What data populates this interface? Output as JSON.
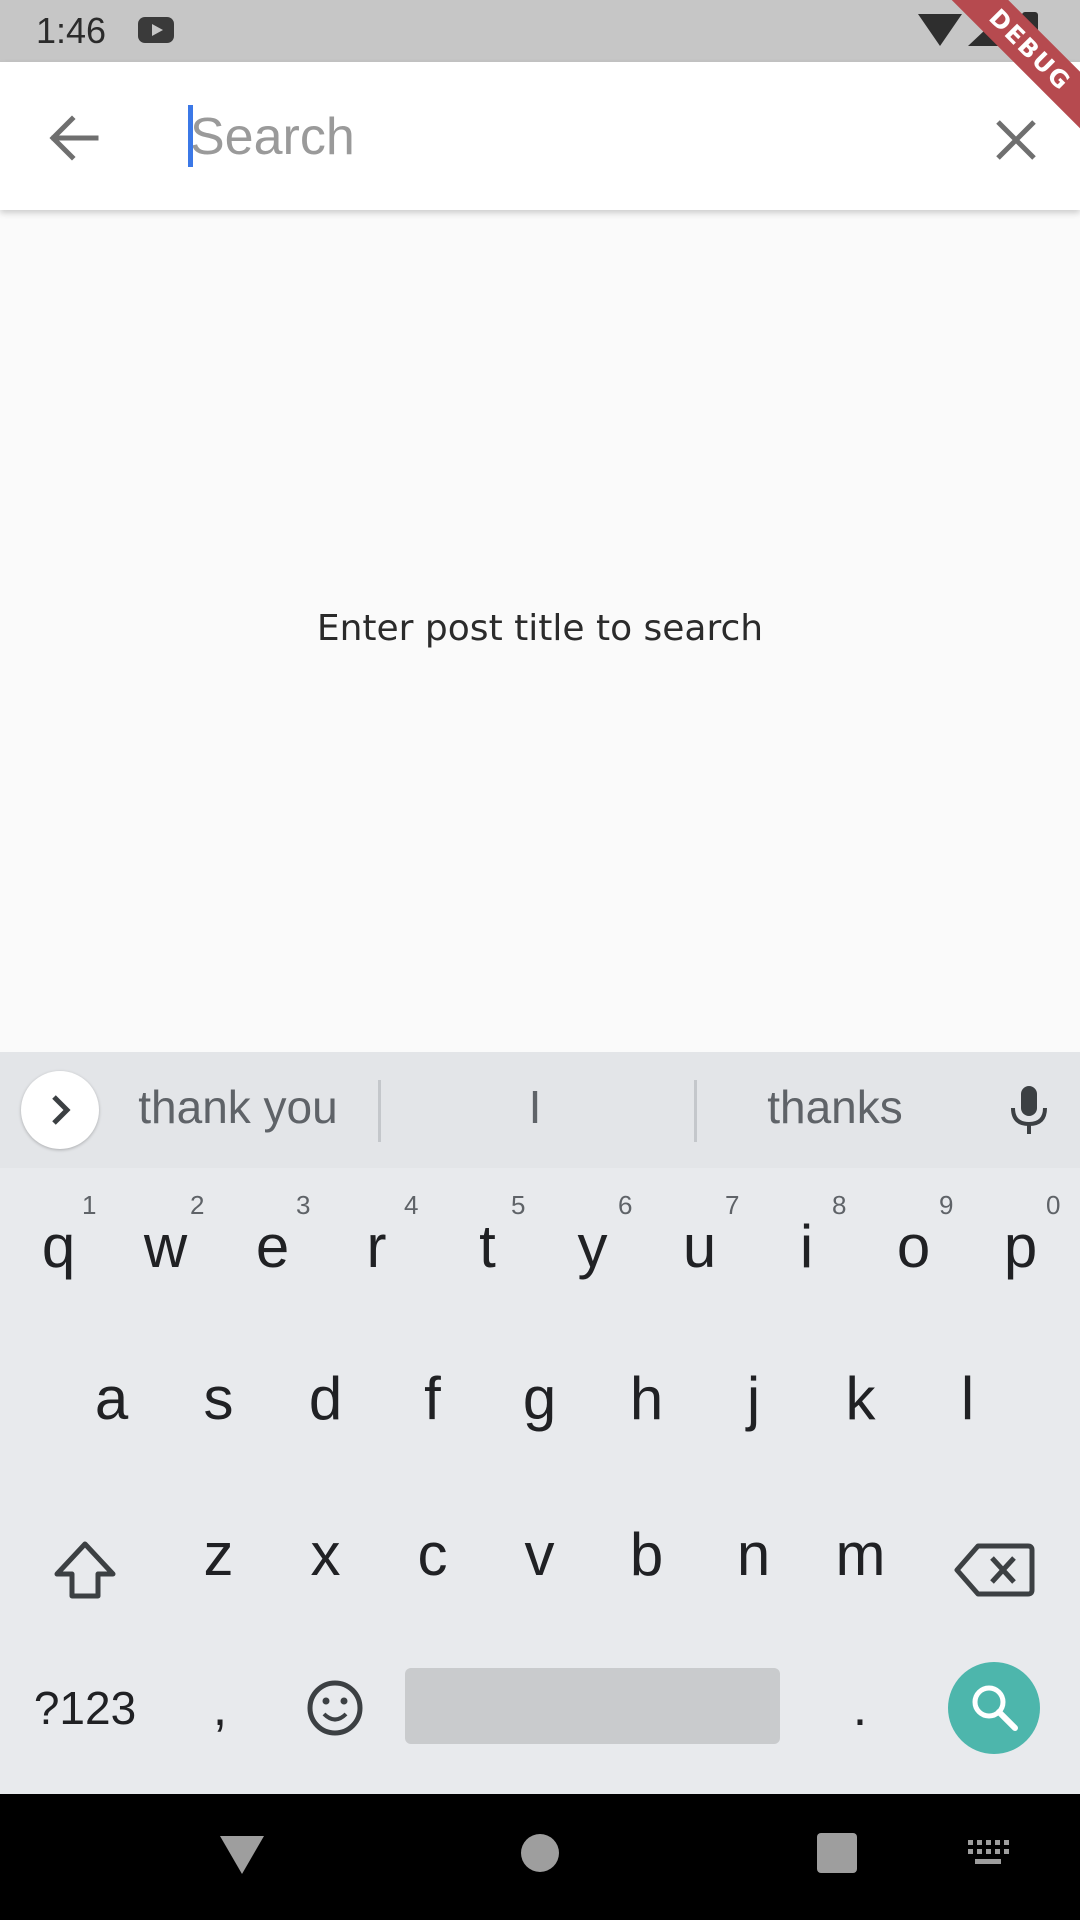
{
  "status_bar": {
    "time": "1:46",
    "debug_label": "DEBUG"
  },
  "search": {
    "placeholder": "Search",
    "value": ""
  },
  "main": {
    "empty_message": "Enter post title to search"
  },
  "keyboard": {
    "suggestions": [
      "thank you",
      "I",
      "thanks"
    ],
    "row1": [
      {
        "key": "q",
        "hint": "1"
      },
      {
        "key": "w",
        "hint": "2"
      },
      {
        "key": "e",
        "hint": "3"
      },
      {
        "key": "r",
        "hint": "4"
      },
      {
        "key": "t",
        "hint": "5"
      },
      {
        "key": "y",
        "hint": "6"
      },
      {
        "key": "u",
        "hint": "7"
      },
      {
        "key": "i",
        "hint": "8"
      },
      {
        "key": "o",
        "hint": "9"
      },
      {
        "key": "p",
        "hint": "0"
      }
    ],
    "row2": [
      "a",
      "s",
      "d",
      "f",
      "g",
      "h",
      "j",
      "k",
      "l"
    ],
    "row3": [
      "z",
      "x",
      "c",
      "v",
      "b",
      "n",
      "m"
    ],
    "symbols_label": "?123",
    "comma": ",",
    "period": "."
  },
  "colors": {
    "accent": "#3b78e7",
    "search_key": "#4db6ac",
    "debug_banner": "#b64a4f"
  },
  "icons": [
    "back-arrow-icon",
    "close-icon",
    "chevron-right-icon",
    "mic-icon",
    "shift-icon",
    "backspace-icon",
    "emoji-icon",
    "search-icon",
    "nav-back-icon",
    "nav-home-icon",
    "nav-recents-icon",
    "keyboard-icon"
  ]
}
